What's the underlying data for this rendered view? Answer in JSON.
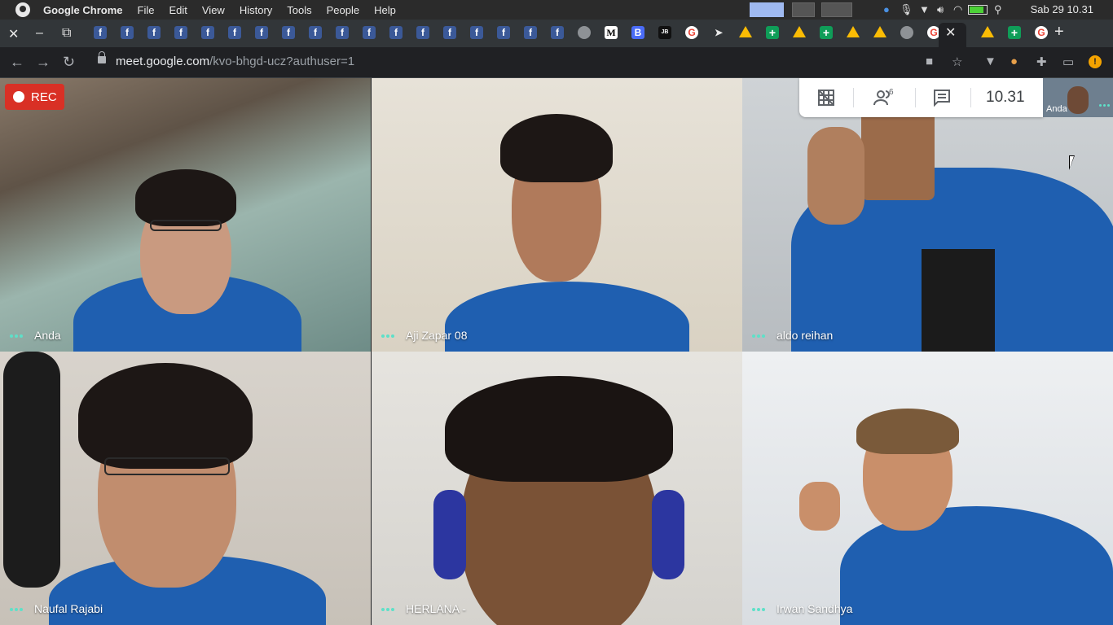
{
  "os_bar": {
    "app_name": "Google Chrome",
    "menus": [
      "File",
      "Edit",
      "View",
      "History",
      "Tools",
      "People",
      "Help"
    ],
    "clock": "Sab 29 10.31"
  },
  "tabs": {
    "favicons": [
      "fb",
      "fb",
      "fb",
      "fb",
      "fb",
      "fb",
      "fb",
      "fb",
      "fb",
      "fb",
      "fb",
      "fb",
      "fb",
      "fb",
      "fb",
      "fb",
      "fb",
      "fb",
      "globe",
      "medium",
      "blogger",
      "jb",
      "google",
      "arrow",
      "drive",
      "sheets",
      "drive",
      "sheets",
      "drive",
      "drive",
      "globe",
      "google",
      "active",
      "drive",
      "sheets",
      "google"
    ],
    "medium_letter": "M",
    "blogger_letter": "B",
    "jb_letter": "JB",
    "google_letter": "G",
    "fb_letter": "f"
  },
  "toolbar": {
    "url_host": "meet.google.com",
    "url_path": "/kvo-bhgd-ucz?authuser=1"
  },
  "meet": {
    "recording_label": "REC",
    "panel": {
      "participant_count": "6",
      "time": "10.31"
    },
    "self_view_label": "Anda",
    "participants": [
      {
        "name": "Anda"
      },
      {
        "name": "Aji Zapar 08"
      },
      {
        "name": "aldo reihan"
      },
      {
        "name": "Naufal Rajabi"
      },
      {
        "name": "HERLANA -"
      },
      {
        "name": "Irwan Sandhya"
      }
    ]
  },
  "colors": {
    "rec_red": "#d93025",
    "speaking_dots": "#5ee0c8",
    "jacket_blue": "#1f5fb0"
  }
}
